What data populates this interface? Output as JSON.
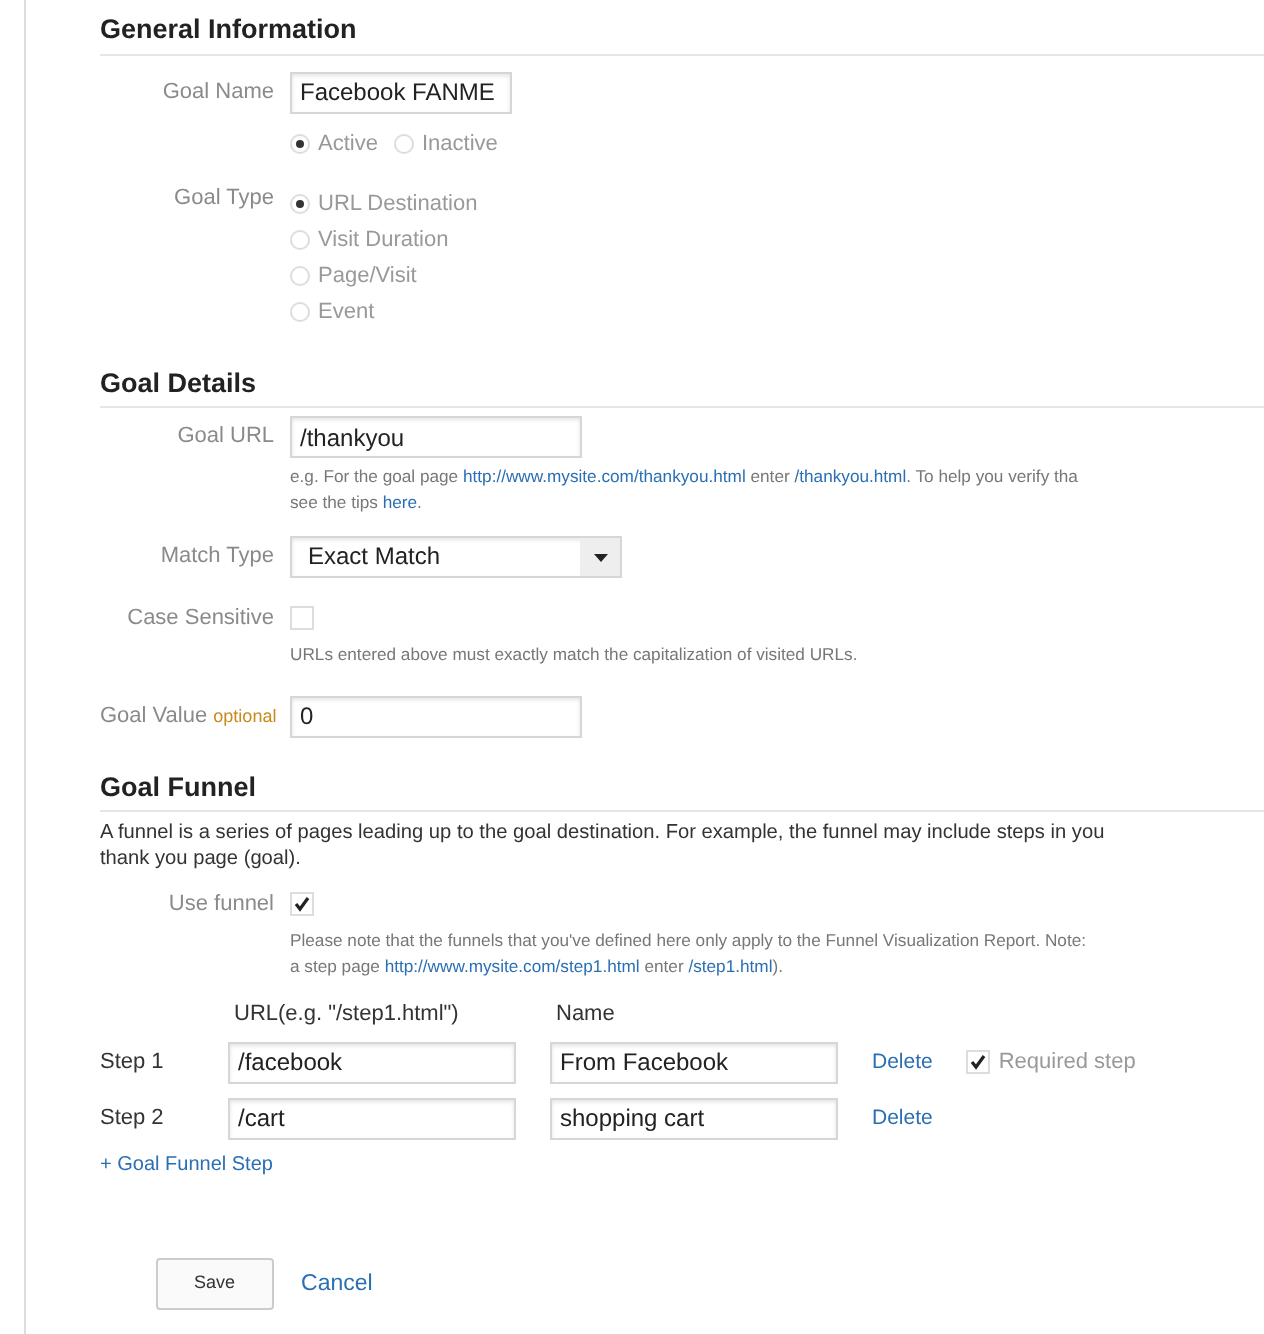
{
  "general_information": {
    "title": "General Information",
    "goal_name": {
      "label": "Goal Name",
      "value": "Facebook FANME"
    },
    "status": [
      {
        "label": "Active",
        "selected": true
      },
      {
        "label": "Inactive",
        "selected": false
      }
    ],
    "goal_type": {
      "label": "Goal Type",
      "options": [
        {
          "label": "URL Destination",
          "selected": true
        },
        {
          "label": "Visit Duration",
          "selected": false
        },
        {
          "label": "Page/Visit",
          "selected": false
        },
        {
          "label": "Event",
          "selected": false
        }
      ]
    }
  },
  "goal_details": {
    "title": "Goal Details",
    "goal_url": {
      "label": "Goal URL",
      "value": "/thankyou",
      "help_lines": [
        [
          {
            "kind": "text",
            "text": "e.g. For the goal page "
          },
          {
            "kind": "link",
            "text": "http://www.mysite.com/thankyou.html"
          },
          {
            "kind": "text",
            "text": " enter "
          },
          {
            "kind": "link",
            "text": "/thankyou.html"
          },
          {
            "kind": "text",
            "text": ". To help you verify tha"
          }
        ],
        [
          {
            "kind": "text",
            "text": "see the tips "
          },
          {
            "kind": "link",
            "text": "here"
          },
          {
            "kind": "text",
            "text": "."
          }
        ]
      ]
    },
    "match_type": {
      "label": "Match Type",
      "value": "Exact Match"
    },
    "case_sensitive": {
      "label": "Case Sensitive",
      "checked": false,
      "help": "URLs entered above must exactly match the capitalization of visited URLs."
    },
    "goal_value": {
      "label": "Goal Value",
      "note": "optional",
      "value": "0"
    }
  },
  "goal_funnel": {
    "title": "Goal Funnel",
    "description_lines": [
      "A funnel is a series of pages leading up to the goal destination. For example, the funnel may include steps in you",
      "thank you page (goal)."
    ],
    "use_funnel": {
      "label": "Use funnel",
      "checked": true,
      "note_lines": [
        [
          {
            "kind": "text",
            "text": "Please note that the funnels that you've defined here only apply to the Funnel Visualization Report. Note:"
          }
        ],
        [
          {
            "kind": "text",
            "text": "a step page "
          },
          {
            "kind": "link",
            "text": "http://www.mysite.com/step1.html"
          },
          {
            "kind": "text",
            "text": " enter "
          },
          {
            "kind": "link",
            "text": "/step1.html"
          },
          {
            "kind": "text",
            "text": ")."
          }
        ]
      ]
    },
    "columns": [
      "URL(e.g. \"/step1.html\")",
      "Name"
    ],
    "steps": [
      {
        "label": "Step 1",
        "url": "/facebook",
        "name": "From Facebook",
        "delete": "Delete",
        "required": {
          "label": "Required step",
          "checked": true
        }
      },
      {
        "label": "Step 2",
        "url": "/cart",
        "name": "shopping cart",
        "delete": "Delete"
      }
    ],
    "add_step": "+ Goal Funnel Step"
  },
  "actions": {
    "save": "Save",
    "cancel": "Cancel"
  }
}
